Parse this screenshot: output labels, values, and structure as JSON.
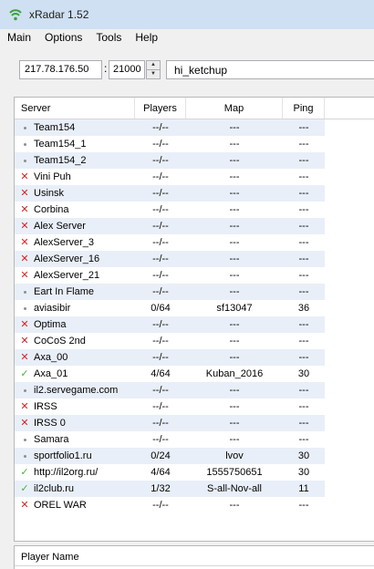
{
  "window": {
    "title": "xRadar 1.52"
  },
  "menu": [
    "Main",
    "Options",
    "Tools",
    "Help"
  ],
  "connection": {
    "ip": "217.78.176.50",
    "separator": ":",
    "port": "21000",
    "player_name": "hi_ketchup"
  },
  "columns": {
    "server": "Server",
    "players": "Players",
    "map": "Map",
    "ping": "Ping"
  },
  "servers": [
    {
      "status": "unknown",
      "name": "Team154",
      "players": "--/--",
      "map": "---",
      "ping": "---"
    },
    {
      "status": "unknown",
      "name": "Team154_1",
      "players": "--/--",
      "map": "---",
      "ping": "---"
    },
    {
      "status": "unknown",
      "name": "Team154_2",
      "players": "--/--",
      "map": "---",
      "ping": "---"
    },
    {
      "status": "offline",
      "name": "Vini Puh",
      "players": "--/--",
      "map": "---",
      "ping": "---"
    },
    {
      "status": "offline",
      "name": "Usinsk",
      "players": "--/--",
      "map": "---",
      "ping": "---"
    },
    {
      "status": "offline",
      "name": "Corbina",
      "players": "--/--",
      "map": "---",
      "ping": "---"
    },
    {
      "status": "offline",
      "name": "Alex Server",
      "players": "--/--",
      "map": "---",
      "ping": "---"
    },
    {
      "status": "offline",
      "name": "AlexServer_3",
      "players": "--/--",
      "map": "---",
      "ping": "---"
    },
    {
      "status": "offline",
      "name": "AlexServer_16",
      "players": "--/--",
      "map": "---",
      "ping": "---"
    },
    {
      "status": "offline",
      "name": "AlexServer_21",
      "players": "--/--",
      "map": "---",
      "ping": "---"
    },
    {
      "status": "unknown",
      "name": "Eart In Flame",
      "players": "--/--",
      "map": "---",
      "ping": "---"
    },
    {
      "status": "unknown",
      "name": "aviasibir",
      "players": "0/64",
      "map": "sf13047",
      "ping": "36"
    },
    {
      "status": "offline",
      "name": "Optima",
      "players": "--/--",
      "map": "---",
      "ping": "---"
    },
    {
      "status": "offline",
      "name": "CoCoS 2nd",
      "players": "--/--",
      "map": "---",
      "ping": "---"
    },
    {
      "status": "offline",
      "name": "Axa_00",
      "players": "--/--",
      "map": "---",
      "ping": "---"
    },
    {
      "status": "online",
      "name": "Axa_01",
      "players": "4/64",
      "map": "Kuban_2016",
      "ping": "30"
    },
    {
      "status": "unknown",
      "name": "il2.servegame.com",
      "players": "--/--",
      "map": "---",
      "ping": "---"
    },
    {
      "status": "offline",
      "name": "IRSS",
      "players": "--/--",
      "map": "---",
      "ping": "---"
    },
    {
      "status": "offline",
      "name": "IRSS 0",
      "players": "--/--",
      "map": "---",
      "ping": "---"
    },
    {
      "status": "unknown",
      "name": "Samara",
      "players": "--/--",
      "map": "---",
      "ping": "---"
    },
    {
      "status": "unknown",
      "name": "sportfolio1.ru",
      "players": "0/24",
      "map": "lvov",
      "ping": "30"
    },
    {
      "status": "online",
      "name": "http://il2org.ru/",
      "players": "4/64",
      "map": "1555750651",
      "ping": "30"
    },
    {
      "status": "online",
      "name": "il2club.ru",
      "players": "1/32",
      "map": "S-all-Nov-all",
      "ping": "11"
    },
    {
      "status": "offline",
      "name": "OREL WAR",
      "players": "--/--",
      "map": "---",
      "ping": "---"
    }
  ],
  "player_panel": {
    "header": "Player Name"
  },
  "colors": {
    "titlebar": "#cfe0f3",
    "row_alt": "#e9eff8",
    "offline": "#e02020",
    "online": "#44b33a",
    "unknown": "#8e8e8e"
  },
  "icons": {
    "app": "radar-icon",
    "offline": "red-x-icon",
    "online": "green-check-icon",
    "unknown": "grey-dot-icon"
  }
}
